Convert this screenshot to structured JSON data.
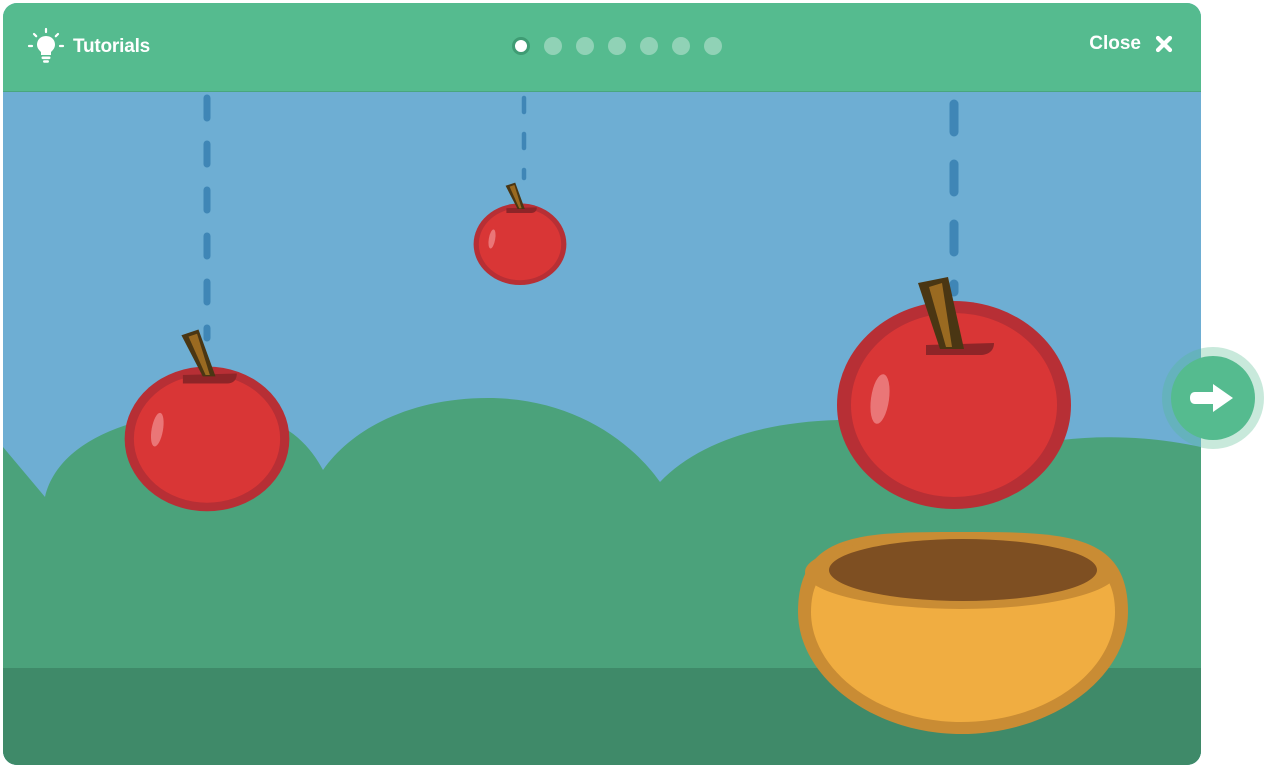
{
  "header": {
    "title": "Tutorials",
    "close_label": "Close",
    "icon_lightbulb": "lightbulb-icon",
    "icon_close": "close-icon"
  },
  "pagination": {
    "total": 7,
    "current": 1
  },
  "next_button": {
    "icon": "arrow-right-icon"
  },
  "colors": {
    "header": "#55bb8f",
    "sky": "#6eaed3",
    "hills": "#4ba27b",
    "ground": "#3f8a69",
    "apple": "#d93636",
    "apple_outline": "#b72f35",
    "bowl": "#f0ad41",
    "bowl_rim": "#c98c34",
    "bowl_inside": "#7e4f22"
  }
}
